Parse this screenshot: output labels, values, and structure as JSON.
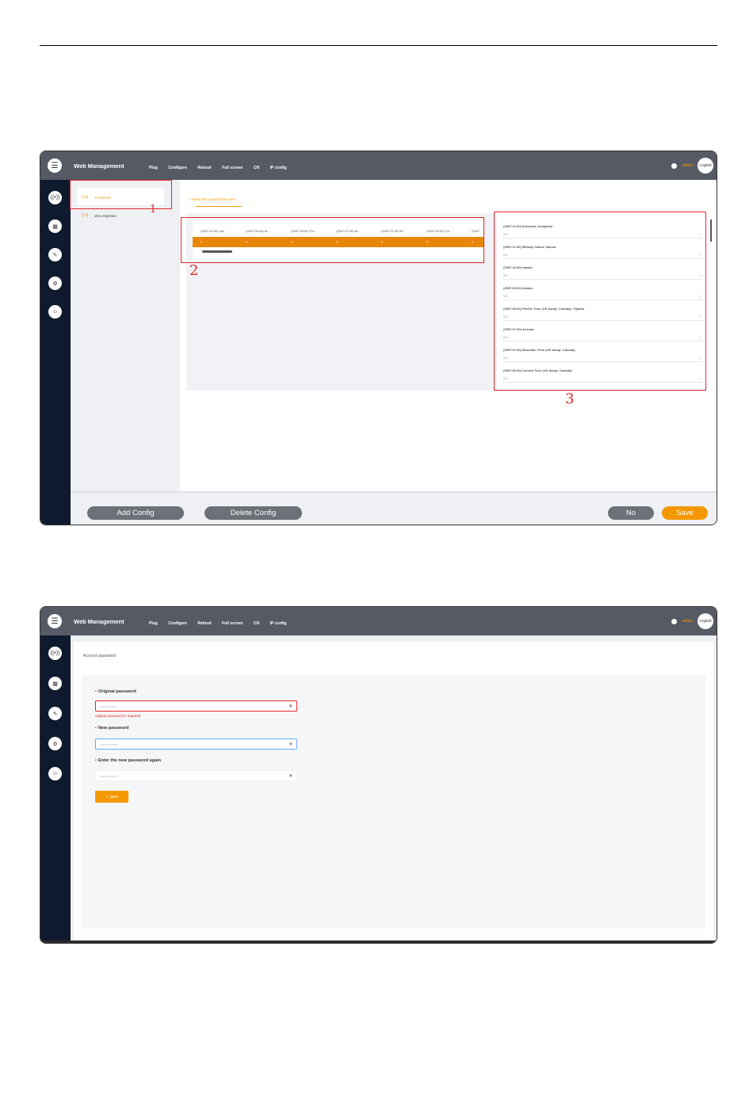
{
  "header": {
    "title": "Web Management",
    "menu": [
      "Plug",
      "Configure",
      "Reboot",
      "Full screen",
      "CN",
      "IP config"
    ],
    "user": "admin",
    "logout": "Logout"
  },
  "shot1": {
    "sub_items": [
      "TimeZone",
      "Zero Injection"
    ],
    "tz_title": "Select the current time zone",
    "table_headers": [
      "(GMT-10:00) Ha...",
      "(GMT-09:00) Al...",
      "(GMT-08:00) Pa...",
      "(GMT-07:00) Ar...",
      "(GMT-07:00) M...",
      "(GMT-06:00) Ce...",
      "(GMT"
    ],
    "table_values": [
      "0",
      "0",
      "0",
      "0",
      "0",
      "0",
      "0"
    ],
    "timezones": [
      {
        "label": "(GMT-12:00) Eniwetok, Kwajalein",
        "value": "NO"
      },
      {
        "label": "(GMT-11:00) Midway Island, Samoa",
        "value": "NO"
      },
      {
        "label": "(GMT-10:00) Hawaii",
        "value": "NO"
      },
      {
        "label": "(GMT-09:00) Alaska",
        "value": "NO"
      },
      {
        "label": "(GMT-08:00) Pacific Time (US &amp; Canada); Tijuana",
        "value": "NO"
      },
      {
        "label": "(GMT-07:00) Arizona",
        "value": "NO"
      },
      {
        "label": "(GMT-07:00) Mountain Time (US &amp; Canada)",
        "value": "NO"
      },
      {
        "label": "(GMT-06:00) Central Time (US &amp; Canada)",
        "value": "NO"
      }
    ],
    "buttons": {
      "add": "Add Config",
      "delete": "Delete Config",
      "no": "No",
      "save": "Save"
    },
    "annotations": [
      "1",
      "2",
      "3"
    ]
  },
  "shot2": {
    "section": "Account password",
    "original_label": "Original password",
    "original_placeholder": "please enter",
    "original_error": "original password is required",
    "new_label": "New password",
    "new_placeholder": "please enter",
    "again_label": "Enter the new password again",
    "again_placeholder": "please enter",
    "save": "save"
  },
  "colors": {
    "accent": "#f39800",
    "header": "#565a65",
    "sidebar": "#0f1a2e",
    "annotation": "#e0282a"
  }
}
